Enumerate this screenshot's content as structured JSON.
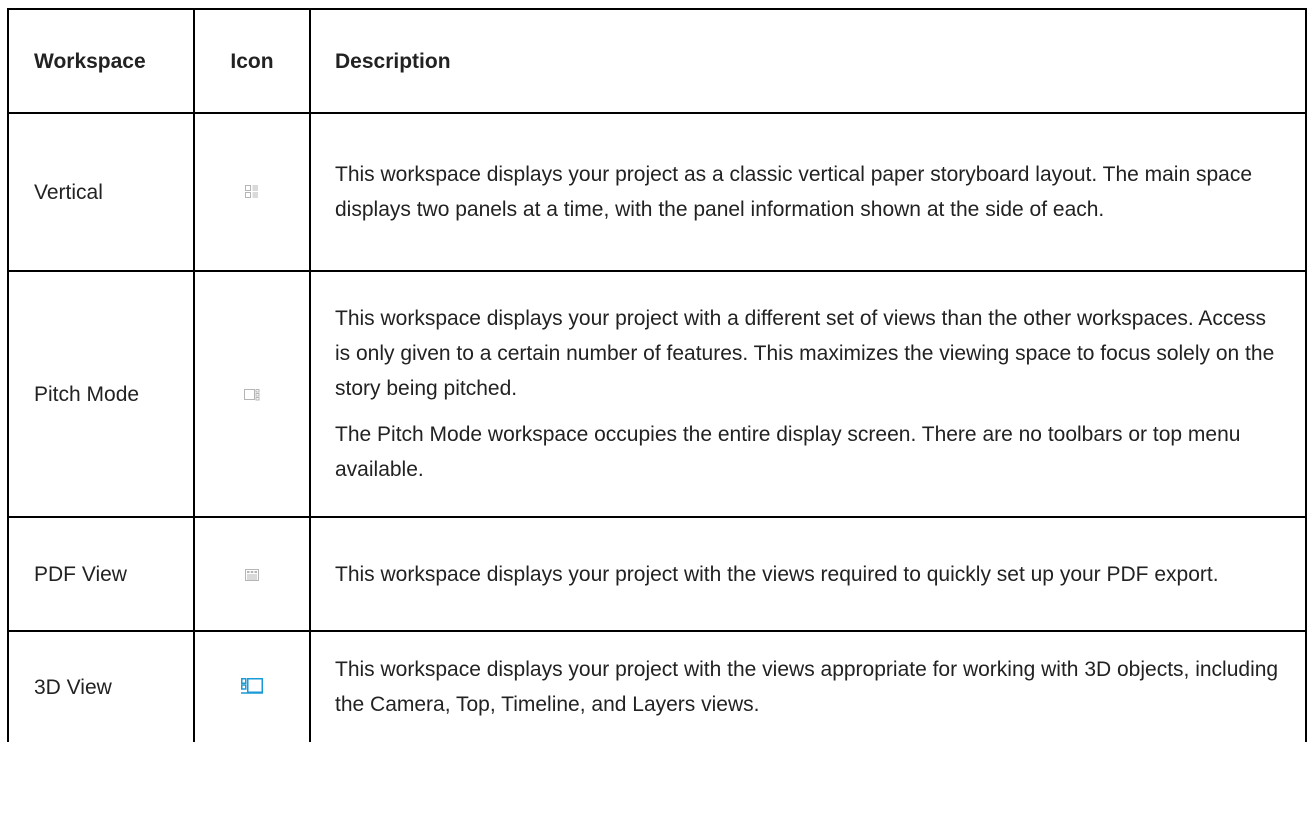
{
  "table": {
    "headers": {
      "workspace": "Workspace",
      "icon": "Icon",
      "description": "Description"
    },
    "rows": [
      {
        "name": "Vertical",
        "icon": "vertical-layout-icon",
        "description": [
          "This workspace displays your project as a classic vertical paper storyboard layout. The main space displays two panels at a time, with the panel information shown at the side of each."
        ]
      },
      {
        "name": "Pitch Mode",
        "icon": "pitch-mode-icon",
        "description": [
          "This workspace displays your project with a different set of views than the other workspaces. Access is only given to a certain number of features. This maximizes the viewing space to focus solely on the story being pitched.",
          "The Pitch Mode workspace occupies the entire display screen. There are no toolbars or top menu available."
        ]
      },
      {
        "name": "PDF View",
        "icon": "pdf-view-icon",
        "description": [
          "This workspace displays your project with the views required to quickly set up your PDF export."
        ]
      },
      {
        "name": "3D View",
        "icon": "3d-view-icon",
        "description": [
          "This workspace displays your project with the views appropriate for working with 3D objects, including the Camera, Top, Timeline, and Layers views."
        ]
      }
    ]
  },
  "colors": {
    "icon_gray": "#b5b5b5",
    "icon_blue": "#1a9ad6",
    "border": "#000000",
    "text": "#222222"
  }
}
